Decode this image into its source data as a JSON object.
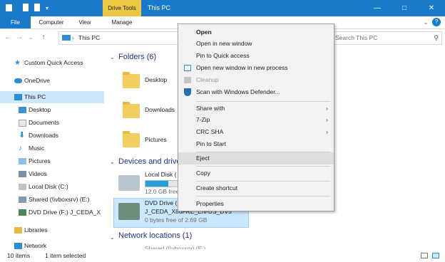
{
  "titlebar": {
    "contextual_tab": "Drive Tools",
    "title": "This PC",
    "minimize": "—",
    "maximize": "□",
    "close": "✕"
  },
  "ribbon": {
    "tabs": [
      "File",
      "Computer",
      "View",
      "Manage"
    ]
  },
  "address": {
    "path": "This PC",
    "search_placeholder": "Search This PC"
  },
  "nav": [
    {
      "label": "Custom Quick Access",
      "icon": "star-icon"
    },
    {
      "label": "OneDrive",
      "icon": "cloud-icon"
    },
    {
      "label": "This PC",
      "icon": "computer-icon",
      "selected": true
    },
    {
      "label": "Desktop",
      "icon": "desktop-folder-icon"
    },
    {
      "label": "Documents",
      "icon": "documents-folder-icon"
    },
    {
      "label": "Downloads",
      "icon": "downloads-folder-icon"
    },
    {
      "label": "Music",
      "icon": "music-folder-icon"
    },
    {
      "label": "Pictures",
      "icon": "pictures-folder-icon"
    },
    {
      "label": "Videos",
      "icon": "videos-folder-icon"
    },
    {
      "label": "Local Disk (C:)",
      "icon": "drive-icon"
    },
    {
      "label": "Shared (\\\\vboxsrv) (E:)",
      "icon": "network-drive-icon"
    },
    {
      "label": "DVD Drive (F:) J_CEDA_X",
      "icon": "dvd-drive-icon"
    },
    {
      "label": "Libraries",
      "icon": "libraries-icon"
    },
    {
      "label": "Network",
      "icon": "network-icon"
    }
  ],
  "content": {
    "folders_header": "Folders (6)",
    "folders": [
      "Desktop",
      "Downloads",
      "Pictures"
    ],
    "devices_header": "Devices and drives",
    "local_disk": {
      "name": "Local Disk (",
      "free": "12.0 GB free",
      "used_fraction": 0.7
    },
    "dvd": {
      "name": "DVD Drive (",
      "label": "J_CEDA_X86FRE_EN-US_DV5",
      "free": "0 bytes free of 2.69 GB"
    },
    "network_header": "Network locations (1)",
    "network_partial": "Shared (\\\\vboxsrv) (E:)"
  },
  "menu": {
    "items": [
      {
        "label": "Open",
        "bold": true
      },
      {
        "label": "Open in new window"
      },
      {
        "label": "Pin to Quick access"
      },
      {
        "label": "Open new window in new process",
        "icon": "window-icon"
      },
      {
        "label": "Cleanup",
        "disabled": true,
        "icon": "cleanup-icon"
      },
      {
        "label": "Scan with Windows Defender...",
        "icon": "defender-icon"
      },
      {
        "label": "Share with",
        "submenu": true
      },
      {
        "label": "7-Zip",
        "submenu": true
      },
      {
        "label": "CRC SHA",
        "submenu": true
      },
      {
        "label": "Pin to Start"
      },
      {
        "label": "Eject",
        "highlight": true
      },
      {
        "label": "Copy"
      },
      {
        "label": "Create shortcut"
      },
      {
        "label": "Properties"
      }
    ]
  },
  "status": {
    "count": "10 items",
    "selected": "1 item selected"
  },
  "colors": {
    "accent": "#1979ca",
    "contextual": "#ecc742",
    "selection": "#cce8ff"
  }
}
